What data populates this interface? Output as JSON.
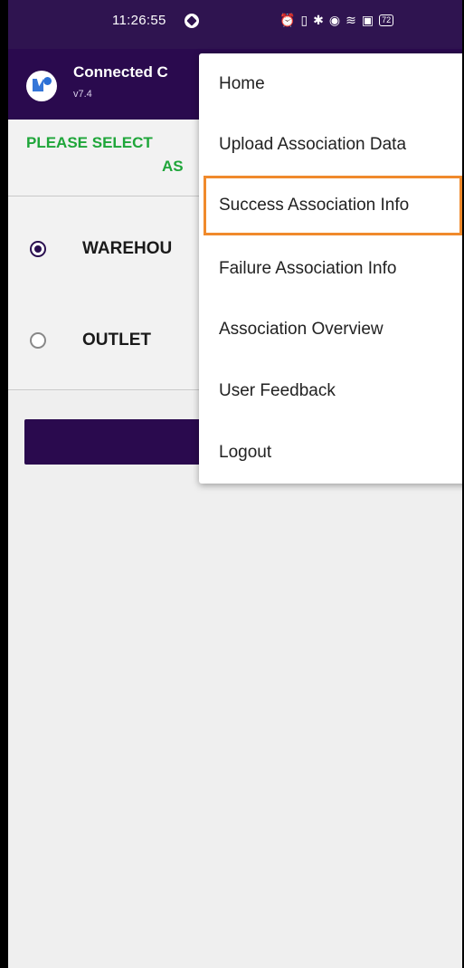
{
  "status_bar": {
    "time": "11:26:55",
    "icons": [
      "alarm-icon",
      "vibrate-icon",
      "bluetooth-icon",
      "location-icon",
      "wifi-icon",
      "screenshot-icon",
      "battery-icon"
    ],
    "battery": "72"
  },
  "app_bar": {
    "title": "Connected C",
    "version": "v7.4"
  },
  "main": {
    "prompt_line1": "PLEASE SELECT",
    "prompt_line2": "AS",
    "options": [
      {
        "label": "WAREHOU",
        "selected": true
      },
      {
        "label": "OUTLET",
        "selected": false
      }
    ]
  },
  "menu": {
    "items": [
      {
        "label": "Home"
      },
      {
        "label": "Upload Association Data"
      },
      {
        "label": "Success Association Info",
        "highlighted": true
      },
      {
        "label": "Failure Association Info"
      },
      {
        "label": "Association Overview"
      },
      {
        "label": "User Feedback"
      },
      {
        "label": "Logout"
      }
    ],
    "highlight_color": "#f08a2c"
  },
  "colors": {
    "app_bar": "#2a0a4e",
    "prompt_text": "#1fa63a",
    "primary_button": "#2a0a4e"
  }
}
